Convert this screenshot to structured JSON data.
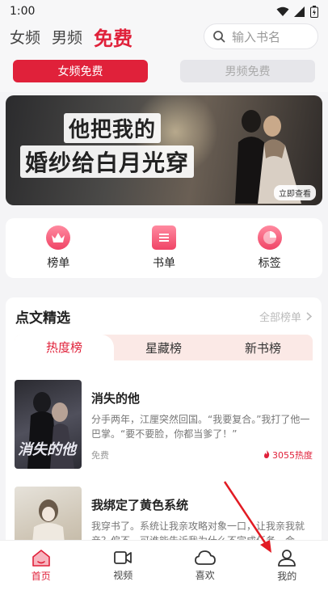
{
  "status": {
    "time": "1:00"
  },
  "topnav": {
    "tabs": [
      "女频",
      "男频",
      "免费"
    ],
    "search_placeholder": "输入书名"
  },
  "subtabs": [
    "女频免费",
    "男频免费"
  ],
  "banner": {
    "line1": "他把我的",
    "line2": "婚纱给白月光穿",
    "cta": "立即查看"
  },
  "quick": [
    "榜单",
    "书单",
    "标签"
  ],
  "picks": {
    "title": "点文精选",
    "more": "全部榜单",
    "tabs": [
      "热度榜",
      "星藏榜",
      "新书榜"
    ],
    "books": [
      {
        "title": "消失的他",
        "cover_text": "消失的他",
        "desc": "分手两年，江厘突然回国。“我要复合。”我打了他一巴掌。“要不要脸，你都当爹了！”",
        "price": "免费",
        "heat": "3055热度"
      },
      {
        "title": "我绑定了黄色系统",
        "desc": "我穿书了。系统让我亲攻略对象一口，让我亲我就亲？偏不。可谁能告诉我为什么不完成任务，会…"
      }
    ]
  },
  "bottom_nav": [
    "首页",
    "视频",
    "喜欢",
    "我的"
  ],
  "colors": {
    "accent": "#e0213a"
  }
}
